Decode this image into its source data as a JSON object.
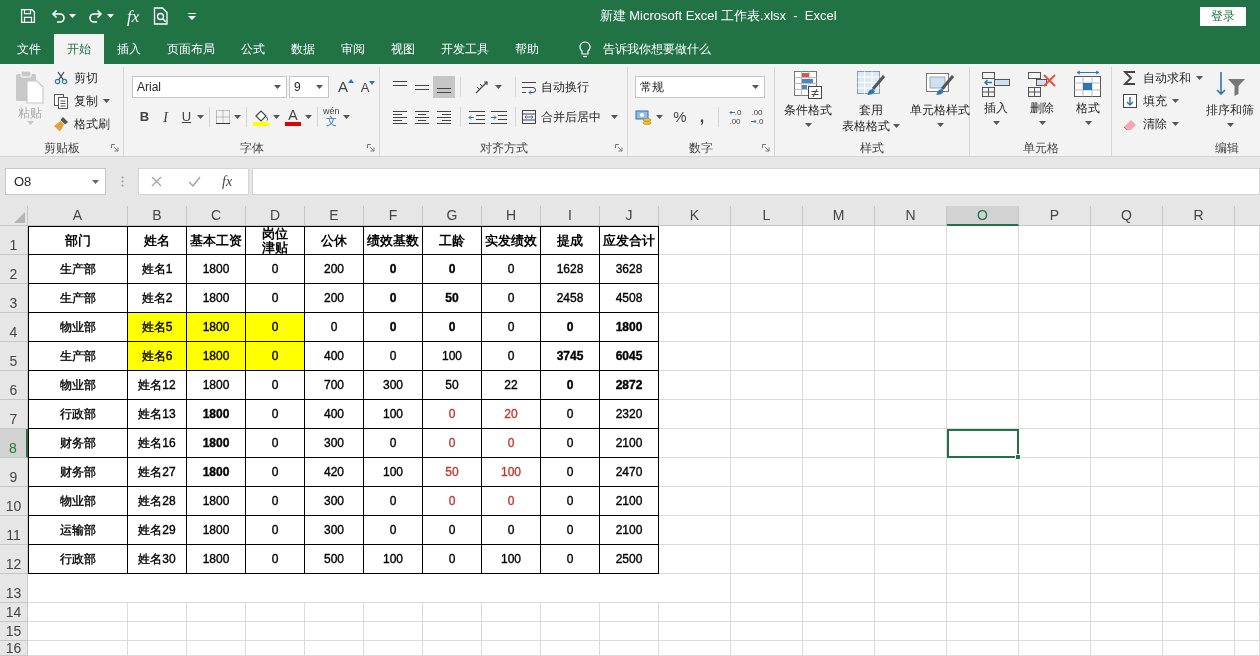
{
  "title_bar": {
    "quick_access": {
      "insert_function": "fx"
    },
    "title": "新建 Microsoft Excel 工作表.xlsx  -  Excel",
    "sign_in": "登录"
  },
  "tabs": [
    {
      "label": "文件",
      "selected": false
    },
    {
      "label": "开始",
      "selected": true
    },
    {
      "label": "插入",
      "selected": false
    },
    {
      "label": "页面布局",
      "selected": false
    },
    {
      "label": "公式",
      "selected": false
    },
    {
      "label": "数据",
      "selected": false
    },
    {
      "label": "审阅",
      "selected": false
    },
    {
      "label": "视图",
      "selected": false
    },
    {
      "label": "开发工具",
      "selected": false
    },
    {
      "label": "帮助",
      "selected": false
    }
  ],
  "tell_me": {
    "placeholder": "告诉我你想要做什么"
  },
  "ribbon": {
    "clipboard": {
      "label": "剪贴板",
      "paste": {
        "label": "粘贴",
        "disabled": true
      },
      "cut": "剪切",
      "copy": "复制",
      "format_painter": "格式刷"
    },
    "font": {
      "label": "字体",
      "name": "Arial",
      "size": "9",
      "grow": "A",
      "shrink": "A",
      "bold": "B",
      "italic": "I",
      "underline": "U",
      "font_color": "A",
      "phonetic": [
        "wén",
        "文"
      ]
    },
    "alignment": {
      "label": "对齐方式",
      "vertical": [
        {
          "selected": false
        },
        {
          "selected": false
        },
        {
          "selected": true
        }
      ],
      "horizontal": [
        {
          "selected": false
        },
        {
          "selected": false
        },
        {
          "selected": false
        }
      ],
      "wrap_text": "自动换行",
      "merge": "合并后居中"
    },
    "number": {
      "label": "数字",
      "format": "常规",
      "percent": "%",
      "comma": ",",
      "increase_decimal": [
        ".0",
        ".00"
      ],
      "decrease_decimal": [
        ".00",
        ".0"
      ]
    },
    "styles": {
      "label": "样式",
      "buttons": [
        {
          "lines": [
            "条件格式"
          ]
        },
        {
          "lines": [
            "套用",
            "表格格式"
          ]
        },
        {
          "lines": [
            "单元格样式"
          ]
        }
      ]
    },
    "cells": {
      "label": "单元格",
      "buttons": [
        "插入",
        "删除",
        "格式"
      ]
    },
    "editing": {
      "label": "编辑",
      "autosum": "自动求和",
      "fill": "填充",
      "clear": "清除",
      "sort_filter": "排序和筛"
    }
  },
  "formula_bar": {
    "name_box": "O8",
    "insert_function": "fx"
  },
  "sheet": {
    "columns": [
      {
        "label": "A",
        "selected": false
      },
      {
        "label": "B",
        "selected": false
      },
      {
        "label": "C",
        "selected": false
      },
      {
        "label": "D",
        "selected": false
      },
      {
        "label": "E",
        "selected": false
      },
      {
        "label": "F",
        "selected": false
      },
      {
        "label": "G",
        "selected": false
      },
      {
        "label": "H",
        "selected": false
      },
      {
        "label": "I",
        "selected": false
      },
      {
        "label": "J",
        "selected": false
      },
      {
        "label": "K",
        "selected": false
      },
      {
        "label": "L",
        "selected": false
      },
      {
        "label": "M",
        "selected": false
      },
      {
        "label": "N",
        "selected": false
      },
      {
        "label": "O",
        "selected": true
      },
      {
        "label": "P",
        "selected": false
      },
      {
        "label": "Q",
        "selected": false
      },
      {
        "label": "R",
        "selected": false
      }
    ],
    "rows": [
      {
        "label": "1",
        "selected": false
      },
      {
        "label": "2",
        "selected": false
      },
      {
        "label": "3",
        "selected": false
      },
      {
        "label": "4",
        "selected": false
      },
      {
        "label": "5",
        "selected": false
      },
      {
        "label": "6",
        "selected": false
      },
      {
        "label": "7",
        "selected": false
      },
      {
        "label": "8",
        "selected": true
      },
      {
        "label": "9",
        "selected": false
      },
      {
        "label": "10",
        "selected": false
      },
      {
        "label": "11",
        "selected": false
      },
      {
        "label": "12",
        "selected": false
      },
      {
        "label": "13",
        "selected": false
      },
      {
        "label": "14",
        "selected": false
      },
      {
        "label": "15",
        "selected": false
      },
      {
        "label": "16",
        "selected": false
      }
    ],
    "table": {
      "header": [
        {
          "lines": [
            "部门"
          ]
        },
        {
          "lines": [
            "姓名"
          ]
        },
        {
          "lines": [
            "基本工资"
          ]
        },
        {
          "lines": [
            "岗位",
            "津贴"
          ]
        },
        {
          "lines": [
            "公休"
          ]
        },
        {
          "lines": [
            "绩效基数"
          ]
        },
        {
          "lines": [
            "工龄"
          ]
        },
        {
          "lines": [
            "实发绩效"
          ]
        },
        {
          "lines": [
            "提成"
          ]
        },
        {
          "lines": [
            "应发合计"
          ]
        }
      ],
      "rows": [
        {
          "cells": [
            {
              "text": "生产部",
              "bold": false,
              "highlighted": false,
              "color": "#000000"
            },
            {
              "text": "姓名1",
              "bold": false,
              "highlighted": false,
              "color": "#000000"
            },
            {
              "text": "1800",
              "bold": false,
              "highlighted": false,
              "color": "#000000"
            },
            {
              "text": "0",
              "bold": false,
              "highlighted": false,
              "color": "#000000"
            },
            {
              "text": "200",
              "bold": false,
              "highlighted": false,
              "color": "#000000"
            },
            {
              "text": "0",
              "bold": true,
              "highlighted": false,
              "color": "#000000"
            },
            {
              "text": "0",
              "bold": true,
              "highlighted": false,
              "color": "#000000"
            },
            {
              "text": "0",
              "bold": false,
              "highlighted": false,
              "color": "#000000"
            },
            {
              "text": "1628",
              "bold": false,
              "highlighted": false,
              "color": "#000000"
            },
            {
              "text": "3628",
              "bold": false,
              "highlighted": false,
              "color": "#000000"
            }
          ]
        },
        {
          "cells": [
            {
              "text": "生产部",
              "bold": false,
              "highlighted": false,
              "color": "#000000"
            },
            {
              "text": "姓名2",
              "bold": false,
              "highlighted": false,
              "color": "#000000"
            },
            {
              "text": "1800",
              "bold": false,
              "highlighted": false,
              "color": "#000000"
            },
            {
              "text": "0",
              "bold": false,
              "highlighted": false,
              "color": "#000000"
            },
            {
              "text": "200",
              "bold": false,
              "highlighted": false,
              "color": "#000000"
            },
            {
              "text": "0",
              "bold": true,
              "highlighted": false,
              "color": "#000000"
            },
            {
              "text": "50",
              "bold": true,
              "highlighted": false,
              "color": "#000000"
            },
            {
              "text": "0",
              "bold": false,
              "highlighted": false,
              "color": "#000000"
            },
            {
              "text": "2458",
              "bold": false,
              "highlighted": false,
              "color": "#000000"
            },
            {
              "text": "4508",
              "bold": false,
              "highlighted": false,
              "color": "#000000"
            }
          ]
        },
        {
          "cells": [
            {
              "text": "物业部",
              "bold": false,
              "highlighted": false,
              "color": "#000000"
            },
            {
              "text": "姓名5",
              "bold": false,
              "highlighted": true,
              "color": "#000000"
            },
            {
              "text": "1800",
              "bold": false,
              "highlighted": true,
              "color": "#000000"
            },
            {
              "text": "0",
              "bold": false,
              "highlighted": true,
              "color": "#000000"
            },
            {
              "text": "0",
              "bold": false,
              "highlighted": false,
              "color": "#000000"
            },
            {
              "text": "0",
              "bold": true,
              "highlighted": false,
              "color": "#000000"
            },
            {
              "text": "0",
              "bold": true,
              "highlighted": false,
              "color": "#000000"
            },
            {
              "text": "0",
              "bold": false,
              "highlighted": false,
              "color": "#000000"
            },
            {
              "text": "0",
              "bold": true,
              "highlighted": false,
              "color": "#000000"
            },
            {
              "text": "1800",
              "bold": true,
              "highlighted": false,
              "color": "#000000"
            }
          ]
        },
        {
          "cells": [
            {
              "text": "生产部",
              "bold": false,
              "highlighted": false,
              "color": "#000000"
            },
            {
              "text": "姓名6",
              "bold": false,
              "highlighted": true,
              "color": "#000000"
            },
            {
              "text": "1800",
              "bold": false,
              "highlighted": true,
              "color": "#000000"
            },
            {
              "text": "0",
              "bold": false,
              "highlighted": true,
              "color": "#000000"
            },
            {
              "text": "400",
              "bold": false,
              "highlighted": false,
              "color": "#000000"
            },
            {
              "text": "0",
              "bold": false,
              "highlighted": false,
              "color": "#000000"
            },
            {
              "text": "100",
              "bold": false,
              "highlighted": false,
              "color": "#000000"
            },
            {
              "text": "0",
              "bold": false,
              "highlighted": false,
              "color": "#000000"
            },
            {
              "text": "3745",
              "bold": true,
              "highlighted": false,
              "color": "#000000"
            },
            {
              "text": "6045",
              "bold": true,
              "highlighted": false,
              "color": "#000000"
            }
          ]
        },
        {
          "cells": [
            {
              "text": "物业部",
              "bold": false,
              "highlighted": false,
              "color": "#000000"
            },
            {
              "text": "姓名12",
              "bold": false,
              "highlighted": false,
              "color": "#000000"
            },
            {
              "text": "1800",
              "bold": false,
              "highlighted": false,
              "color": "#000000"
            },
            {
              "text": "0",
              "bold": false,
              "highlighted": false,
              "color": "#000000"
            },
            {
              "text": "700",
              "bold": false,
              "highlighted": false,
              "color": "#000000"
            },
            {
              "text": "300",
              "bold": false,
              "highlighted": false,
              "color": "#000000"
            },
            {
              "text": "50",
              "bold": false,
              "highlighted": false,
              "color": "#000000"
            },
            {
              "text": "22",
              "bold": false,
              "highlighted": false,
              "color": "#000000"
            },
            {
              "text": "0",
              "bold": true,
              "highlighted": false,
              "color": "#000000"
            },
            {
              "text": "2872",
              "bold": true,
              "highlighted": false,
              "color": "#000000"
            }
          ]
        },
        {
          "cells": [
            {
              "text": "行政部",
              "bold": false,
              "highlighted": false,
              "color": "#000000"
            },
            {
              "text": "姓名13",
              "bold": false,
              "highlighted": false,
              "color": "#000000"
            },
            {
              "text": "1800",
              "bold": true,
              "highlighted": false,
              "color": "#000000"
            },
            {
              "text": "0",
              "bold": false,
              "highlighted": false,
              "color": "#000000"
            },
            {
              "text": "400",
              "bold": false,
              "highlighted": false,
              "color": "#000000"
            },
            {
              "text": "100",
              "bold": false,
              "highlighted": false,
              "color": "#000000"
            },
            {
              "text": "0",
              "bold": false,
              "highlighted": false,
              "color": "#c0392b"
            },
            {
              "text": "20",
              "bold": false,
              "highlighted": false,
              "color": "#c0392b"
            },
            {
              "text": "0",
              "bold": false,
              "highlighted": false,
              "color": "#000000"
            },
            {
              "text": "2320",
              "bold": false,
              "highlighted": false,
              "color": "#000000"
            }
          ]
        },
        {
          "cells": [
            {
              "text": "财务部",
              "bold": false,
              "highlighted": false,
              "color": "#000000"
            },
            {
              "text": "姓名16",
              "bold": false,
              "highlighted": false,
              "color": "#000000"
            },
            {
              "text": "1800",
              "bold": true,
              "highlighted": false,
              "color": "#000000"
            },
            {
              "text": "0",
              "bold": false,
              "highlighted": false,
              "color": "#000000"
            },
            {
              "text": "300",
              "bold": false,
              "highlighted": false,
              "color": "#000000"
            },
            {
              "text": "0",
              "bold": false,
              "highlighted": false,
              "color": "#000000"
            },
            {
              "text": "0",
              "bold": false,
              "highlighted": false,
              "color": "#c0392b"
            },
            {
              "text": "0",
              "bold": false,
              "highlighted": false,
              "color": "#c0392b"
            },
            {
              "text": "0",
              "bold": false,
              "highlighted": false,
              "color": "#000000"
            },
            {
              "text": "2100",
              "bold": false,
              "highlighted": false,
              "color": "#000000"
            }
          ]
        },
        {
          "cells": [
            {
              "text": "财务部",
              "bold": false,
              "highlighted": false,
              "color": "#000000"
            },
            {
              "text": "姓名27",
              "bold": false,
              "highlighted": false,
              "color": "#000000"
            },
            {
              "text": "1800",
              "bold": true,
              "highlighted": false,
              "color": "#000000"
            },
            {
              "text": "0",
              "bold": false,
              "highlighted": false,
              "color": "#000000"
            },
            {
              "text": "420",
              "bold": false,
              "highlighted": false,
              "color": "#000000"
            },
            {
              "text": "100",
              "bold": false,
              "highlighted": false,
              "color": "#000000"
            },
            {
              "text": "50",
              "bold": false,
              "highlighted": false,
              "color": "#c0392b"
            },
            {
              "text": "100",
              "bold": false,
              "highlighted": false,
              "color": "#c0392b"
            },
            {
              "text": "0",
              "bold": false,
              "highlighted": false,
              "color": "#000000"
            },
            {
              "text": "2470",
              "bold": false,
              "highlighted": false,
              "color": "#000000"
            }
          ]
        },
        {
          "cells": [
            {
              "text": "物业部",
              "bold": false,
              "highlighted": false,
              "color": "#000000"
            },
            {
              "text": "姓名28",
              "bold": false,
              "highlighted": false,
              "color": "#000000"
            },
            {
              "text": "1800",
              "bold": false,
              "highlighted": false,
              "color": "#000000"
            },
            {
              "text": "0",
              "bold": false,
              "highlighted": false,
              "color": "#000000"
            },
            {
              "text": "300",
              "bold": false,
              "highlighted": false,
              "color": "#000000"
            },
            {
              "text": "0",
              "bold": false,
              "highlighted": false,
              "color": "#000000"
            },
            {
              "text": "0",
              "bold": false,
              "highlighted": false,
              "color": "#c0392b"
            },
            {
              "text": "0",
              "bold": false,
              "highlighted": false,
              "color": "#c0392b"
            },
            {
              "text": "0",
              "bold": false,
              "highlighted": false,
              "color": "#000000"
            },
            {
              "text": "2100",
              "bold": false,
              "highlighted": false,
              "color": "#000000"
            }
          ]
        },
        {
          "cells": [
            {
              "text": "运输部",
              "bold": false,
              "highlighted": false,
              "color": "#000000"
            },
            {
              "text": "姓名29",
              "bold": false,
              "highlighted": false,
              "color": "#000000"
            },
            {
              "text": "1800",
              "bold": false,
              "highlighted": false,
              "color": "#000000"
            },
            {
              "text": "0",
              "bold": false,
              "highlighted": false,
              "color": "#000000"
            },
            {
              "text": "300",
              "bold": false,
              "highlighted": false,
              "color": "#000000"
            },
            {
              "text": "0",
              "bold": false,
              "highlighted": false,
              "color": "#000000"
            },
            {
              "text": "0",
              "bold": false,
              "highlighted": false,
              "color": "#000000"
            },
            {
              "text": "0",
              "bold": false,
              "highlighted": false,
              "color": "#000000"
            },
            {
              "text": "0",
              "bold": false,
              "highlighted": false,
              "color": "#000000"
            },
            {
              "text": "2100",
              "bold": false,
              "highlighted": false,
              "color": "#000000"
            }
          ]
        },
        {
          "cells": [
            {
              "text": "行政部",
              "bold": false,
              "highlighted": false,
              "color": "#000000"
            },
            {
              "text": "姓名30",
              "bold": false,
              "highlighted": false,
              "color": "#000000"
            },
            {
              "text": "1800",
              "bold": false,
              "highlighted": false,
              "color": "#000000"
            },
            {
              "text": "0",
              "bold": false,
              "highlighted": false,
              "color": "#000000"
            },
            {
              "text": "500",
              "bold": false,
              "highlighted": false,
              "color": "#000000"
            },
            {
              "text": "100",
              "bold": false,
              "highlighted": false,
              "color": "#000000"
            },
            {
              "text": "0",
              "bold": false,
              "highlighted": false,
              "color": "#000000"
            },
            {
              "text": "100",
              "bold": false,
              "highlighted": false,
              "color": "#000000"
            },
            {
              "text": "0",
              "bold": false,
              "highlighted": false,
              "color": "#000000"
            },
            {
              "text": "2500",
              "bold": false,
              "highlighted": false,
              "color": "#000000"
            }
          ]
        }
      ]
    }
  }
}
